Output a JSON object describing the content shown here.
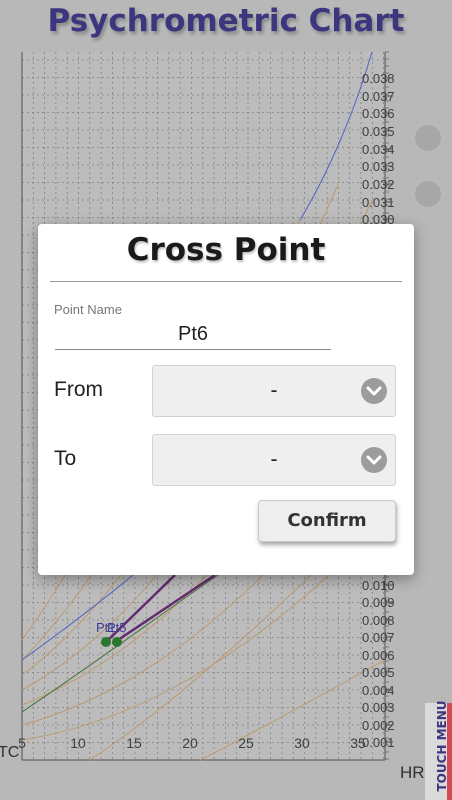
{
  "app": {
    "title": "Psychrometric Chart"
  },
  "chart": {
    "x_axis_unit": "TC",
    "y_axis_unit": "HR",
    "x_ticks": [
      "5",
      "10",
      "15",
      "20",
      "25",
      "30",
      "35"
    ],
    "y_ticks": [
      "0.001",
      "0.002",
      "0.003",
      "0.004",
      "0.005",
      "0.006",
      "0.007",
      "0.008",
      "0.009",
      "0.010",
      "0.030",
      "0.031",
      "0.032",
      "0.033",
      "0.034",
      "0.035",
      "0.036",
      "0.037",
      "0.038"
    ],
    "point_labels": [
      "Pt1",
      "Pt5"
    ],
    "colors": {
      "saturation": "#5a6ad0",
      "rh": "#c9a47a",
      "path": "#6a2f7a",
      "wetbulb": "#4a7a3a",
      "points": "#2e7d32"
    }
  },
  "touch_menu": {
    "label": "TOUCH MENU"
  },
  "dialog": {
    "title": "Cross Point",
    "point_name_label": "Point Name",
    "point_name_value": "Pt6",
    "from_label": "From",
    "from_value": "-",
    "to_label": "To",
    "to_value": "-",
    "confirm_label": "Confirm"
  }
}
